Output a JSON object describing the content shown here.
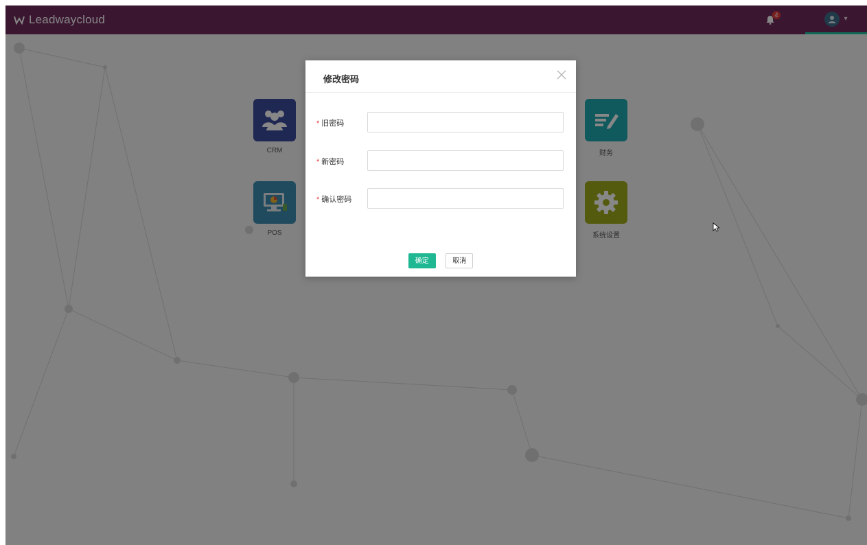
{
  "header": {
    "brand": "Leadwaycloud",
    "notification_count": "4",
    "user_name": "▾"
  },
  "apps": [
    {
      "label": "CRM",
      "color": "#3c4a9e",
      "icon": "users-icon"
    },
    {
      "label": "POS",
      "color": "#3d8fb2",
      "icon": "pos-terminal-icon"
    },
    {
      "label": "财务",
      "color": "#1fa8b0",
      "icon": "edit-doc-icon"
    },
    {
      "label": "系统设置",
      "color": "#a0ad1c",
      "icon": "gear-icon"
    }
  ],
  "modal": {
    "title": "修改密码",
    "fields": [
      {
        "label": "旧密码",
        "value": "",
        "required": true
      },
      {
        "label": "新密码",
        "value": "",
        "required": true
      },
      {
        "label": "确认密码",
        "value": "",
        "required": true
      }
    ],
    "confirm_label": "确定",
    "cancel_label": "取消"
  },
  "colors": {
    "topbar": "#6e2a5c",
    "accent": "#1fb893",
    "required": "#e23b3b"
  }
}
